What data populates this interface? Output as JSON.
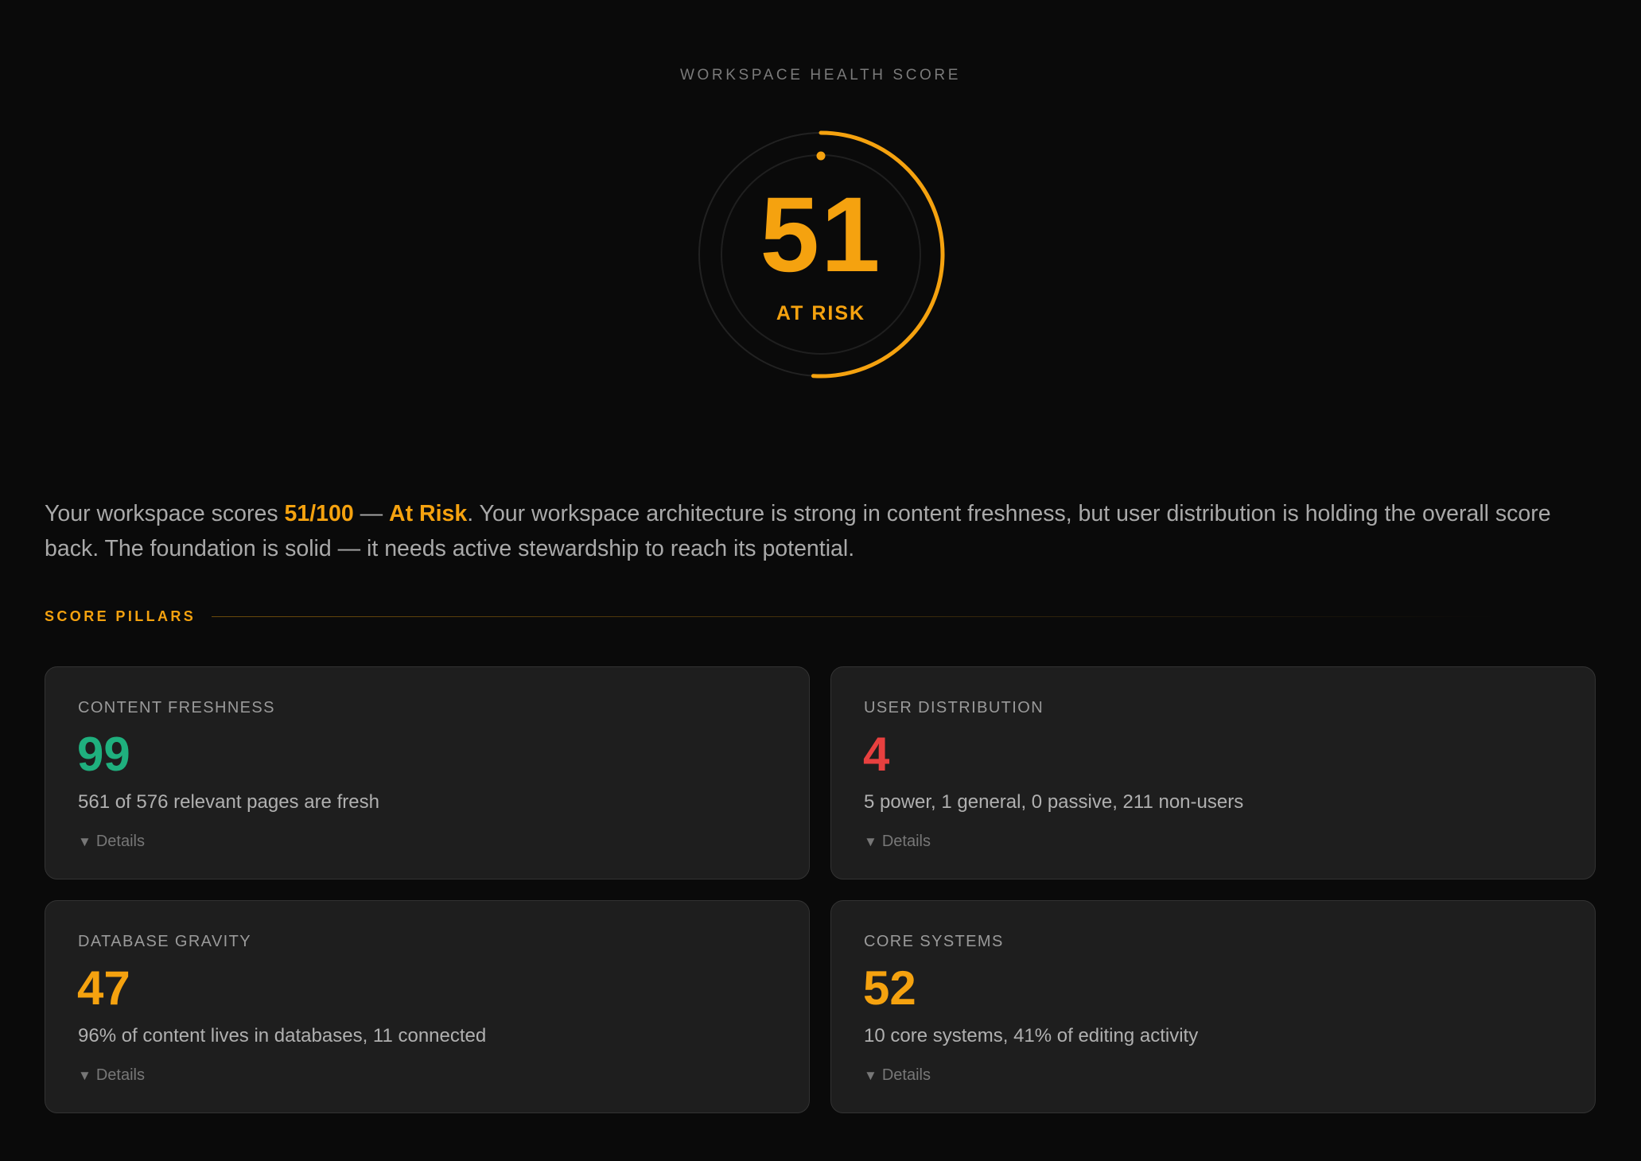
{
  "header": {
    "eyebrow": "WORKSPACE HEALTH SCORE"
  },
  "gauge": {
    "score": "51",
    "score_value": 51,
    "max": 100,
    "status": "AT RISK",
    "accent_color": "#f5a20f",
    "track_color": "#262626"
  },
  "summary": {
    "prefix": "Your workspace scores ",
    "score_text": "51/100",
    "dash": " — ",
    "status_text": "At Risk",
    "body": ". Your workspace architecture is strong in content freshness, but user distribution is holding the overall score back. The foundation is solid — it needs active stewardship to reach its potential."
  },
  "pillars_section": {
    "title": "SCORE PILLARS"
  },
  "pillars": [
    {
      "title": "CONTENT FRESHNESS",
      "value": "99",
      "color": "#1fb07e",
      "description": "561 of 576 relevant pages are fresh",
      "details_label": "Details",
      "details_icon": "triangle-down-icon"
    },
    {
      "title": "USER DISTRIBUTION",
      "value": "4",
      "color": "#e8403f",
      "description": "5 power, 1 general, 0 passive, 211 non-users",
      "details_label": "Details",
      "details_icon": "triangle-down-icon"
    },
    {
      "title": "DATABASE GRAVITY",
      "value": "47",
      "color": "#f5a20f",
      "description": "96% of content lives in databases, 11 connected",
      "details_label": "Details",
      "details_icon": "triangle-down-icon"
    },
    {
      "title": "CORE SYSTEMS",
      "value": "52",
      "color": "#f5a20f",
      "description": "10 core systems, 41% of editing activity",
      "details_label": "Details",
      "details_icon": "triangle-down-icon"
    }
  ]
}
